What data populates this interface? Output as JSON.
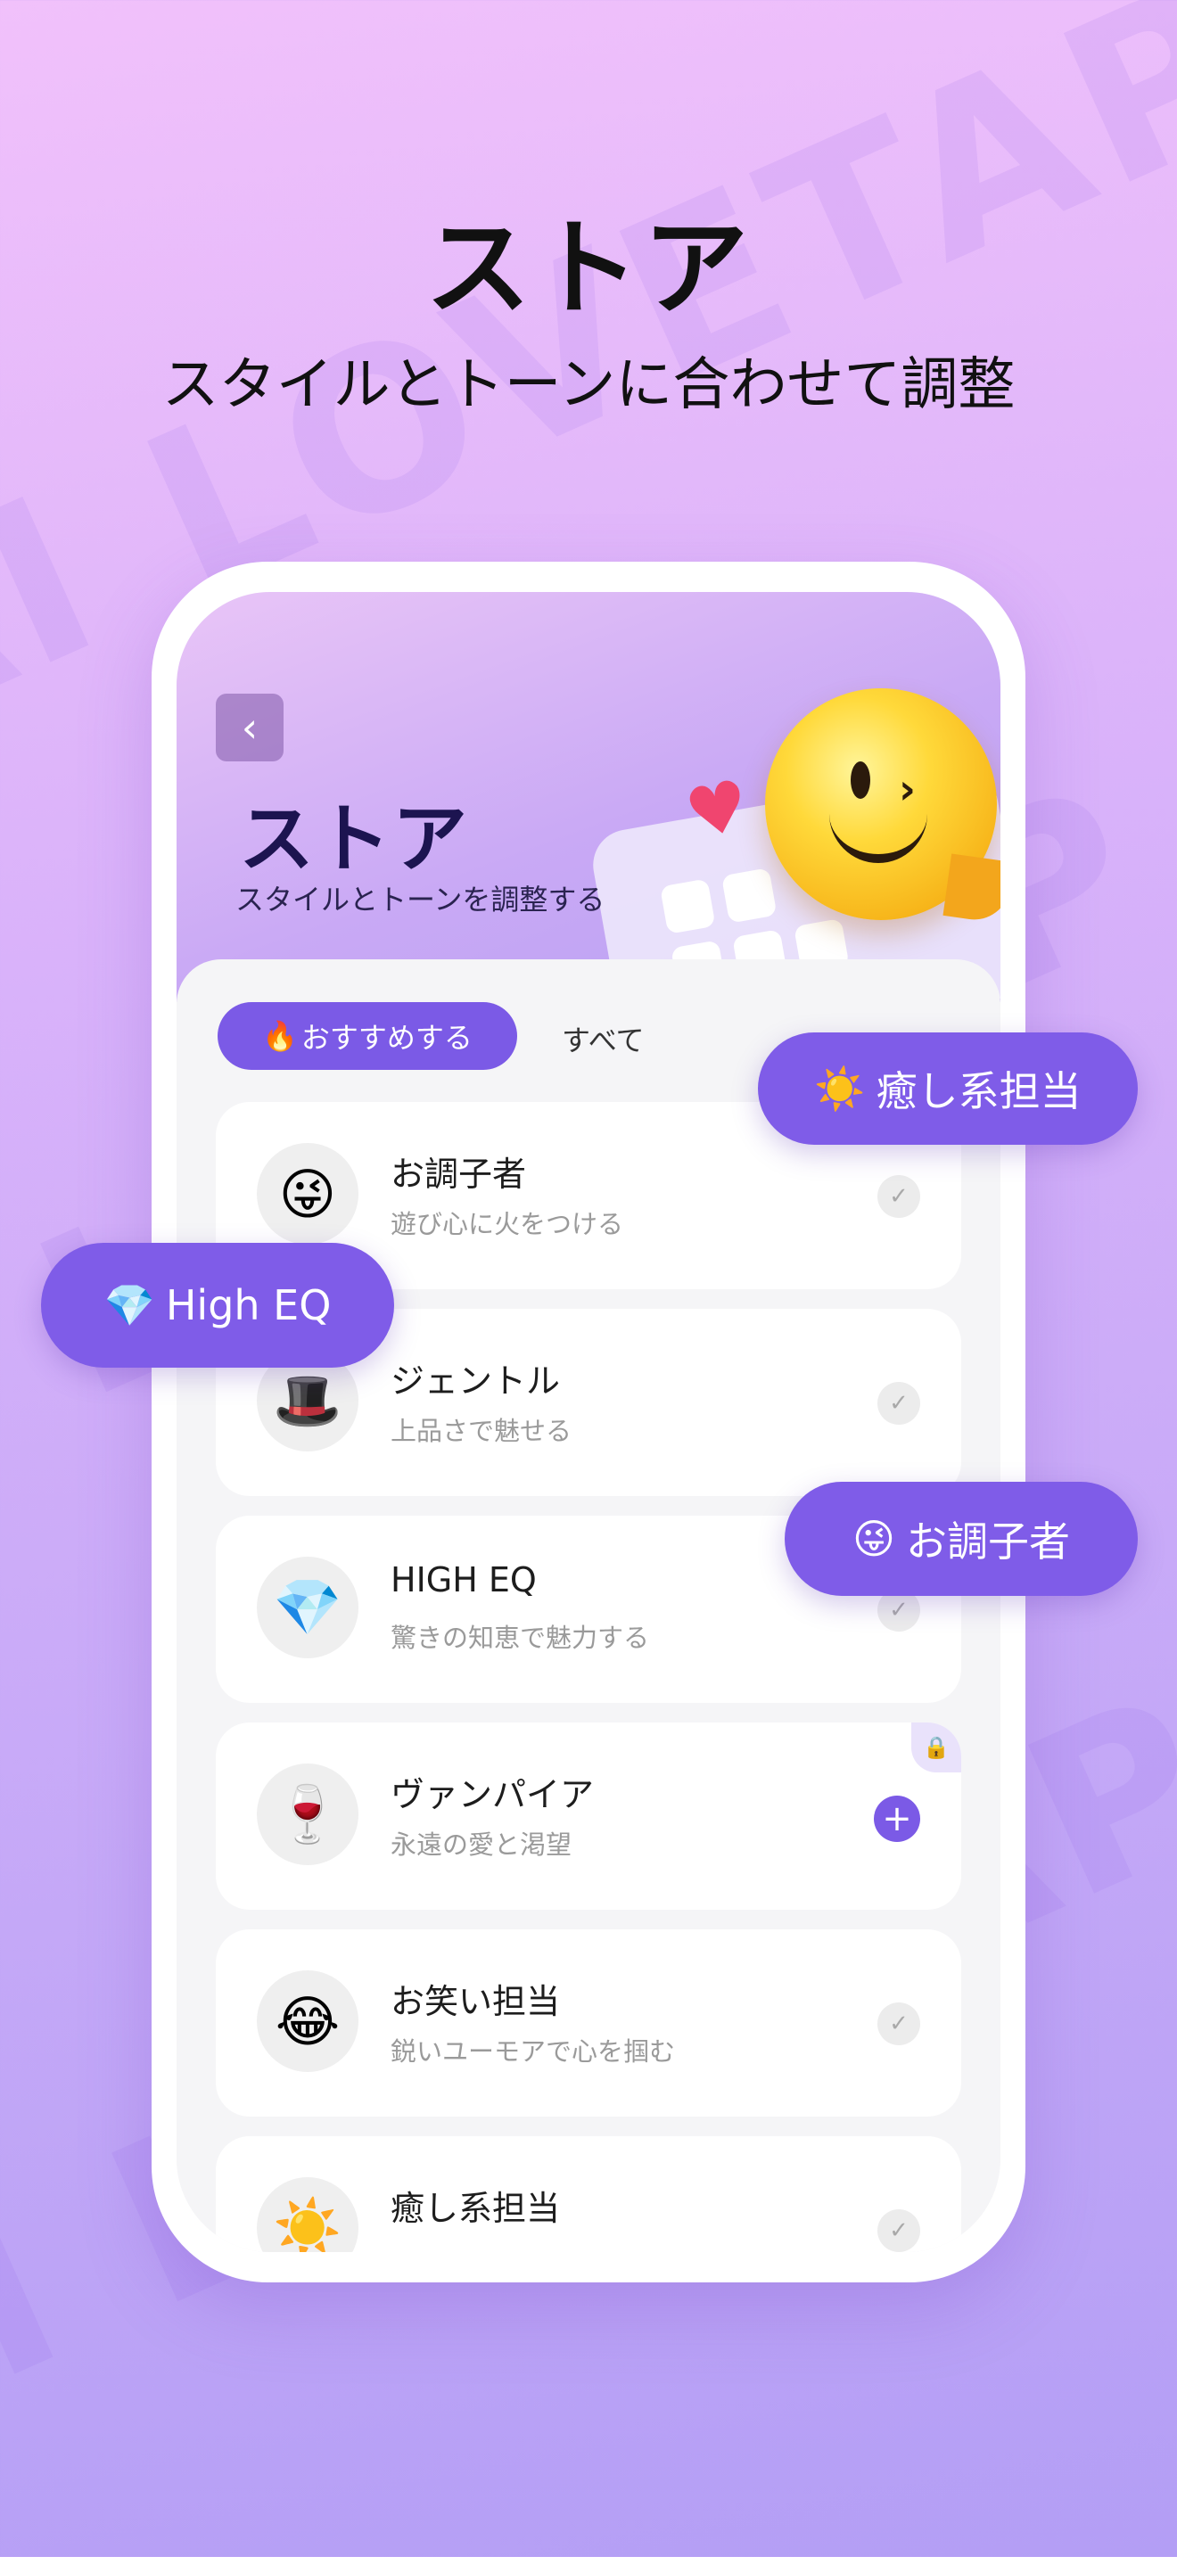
{
  "hero": {
    "title": "ストア",
    "subtitle": "スタイルとトーンに合わせて調整"
  },
  "watermark": "AI LOVETAP",
  "screen": {
    "back_icon": "‹",
    "title": "ストア",
    "subtitle": "スタイルとトーンを調整する",
    "tabs": [
      {
        "label": "おすすめする",
        "icon": "🔥",
        "active": true
      },
      {
        "label": "すべて",
        "active": false
      }
    ],
    "items": [
      {
        "emoji": "😜",
        "name": "お調子者",
        "desc": "遊び心に火をつける",
        "state": "check"
      },
      {
        "emoji": "🎩",
        "name": "ジェントル",
        "desc": "上品さで魅せる",
        "state": "check"
      },
      {
        "emoji": "💎",
        "name": "HIGH EQ",
        "desc": "驚きの知恵で魅力する",
        "state": "check"
      },
      {
        "emoji": "🍷",
        "name": "ヴァンパイア",
        "desc": "永遠の愛と渇望",
        "state": "locked-add"
      },
      {
        "emoji": "😂",
        "name": "お笑い担当",
        "desc": "鋭いユーモアで心を掴む",
        "state": "check"
      },
      {
        "emoji": "☀️",
        "name": "癒し系担当",
        "desc": "",
        "state": "check"
      }
    ]
  },
  "pills": [
    {
      "emoji": "☀️",
      "label": "癒し系担当"
    },
    {
      "emoji": "💎",
      "label": "High EQ"
    },
    {
      "emoji": "😜",
      "label": "お調子者"
    }
  ],
  "icons": {
    "check": "✓",
    "plus": "+",
    "lock": "🔒",
    "heart": "♥",
    "wink": "›"
  },
  "colors": {
    "accent": "#7b5ae6",
    "title": "#1c1450"
  }
}
